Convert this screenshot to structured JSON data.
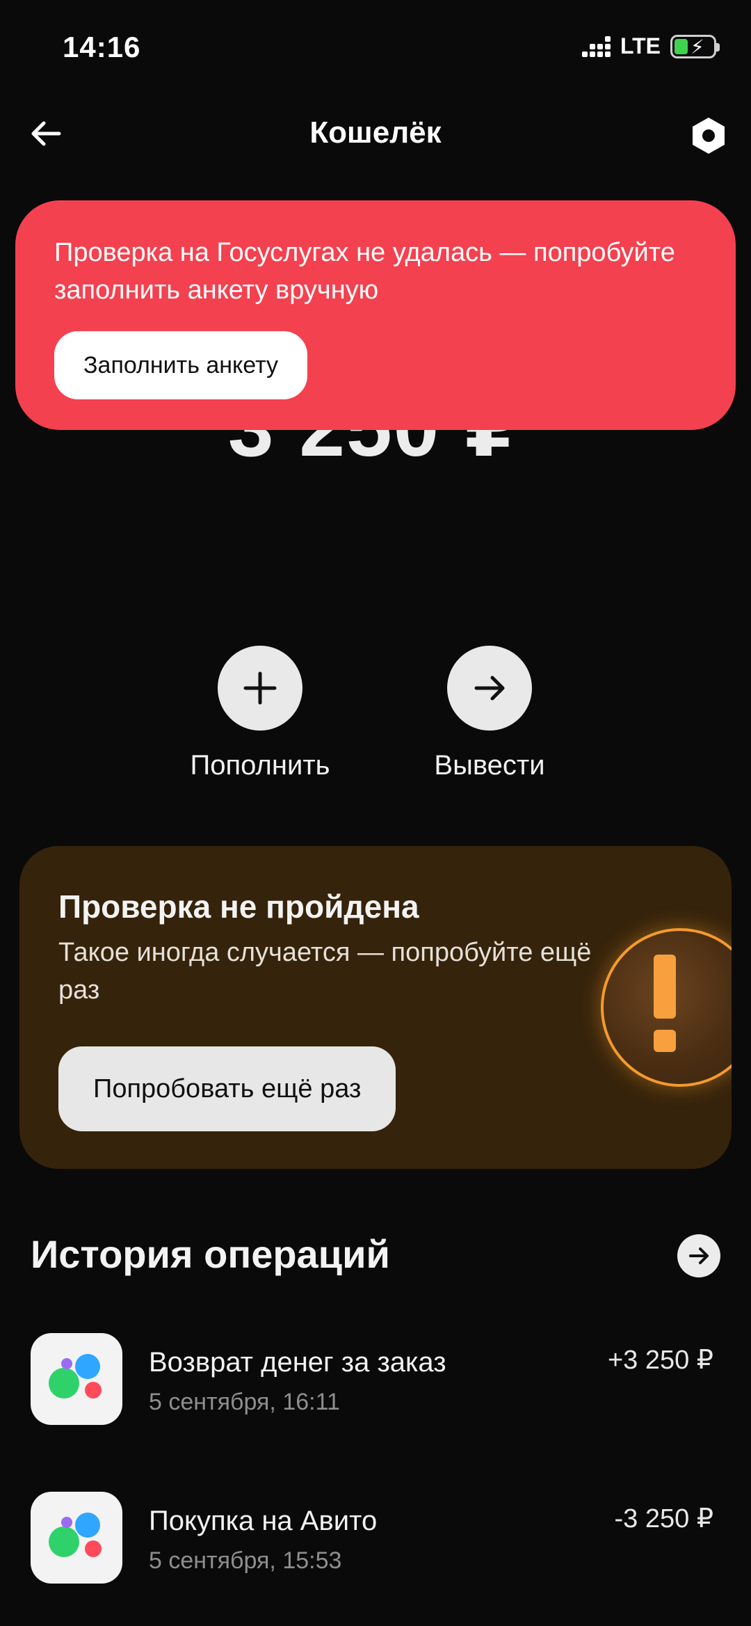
{
  "status_bar": {
    "time": "14:16",
    "network": "LTE",
    "battery_level": 0.35
  },
  "header": {
    "title": "Кошелёк",
    "back_icon": "arrow-left-icon",
    "settings_icon": "hexagon-gear-icon"
  },
  "balance": {
    "value": "3 250 ₽"
  },
  "toast": {
    "message": "Проверка на Госуслугах не удалась — попробуйте заполнить анкету вручную",
    "button_label": "Заполнить анкету",
    "color": "#f4414f"
  },
  "actions": [
    {
      "label": "Пополнить",
      "icon": "plus-icon"
    },
    {
      "label": "Вывести",
      "icon": "arrow-right-icon"
    }
  ],
  "verification": {
    "title": "Проверка не пройдена",
    "text": "Такое иногда случается — попробуйте ещё раз",
    "button_label": "Попробовать ещё раз",
    "icon": "warning-exclamation-icon",
    "accent": "#f59a2d"
  },
  "history": {
    "title": "История операций",
    "operations": [
      {
        "title": "Возврат денег за заказ",
        "date": "5 сентября, 16:11",
        "amount": "+3 250 ₽",
        "icon": "avito-logo-icon"
      },
      {
        "title": "Покупка на Авито",
        "date": "5 сентября, 15:53",
        "amount": "-3 250 ₽",
        "icon": "avito-logo-icon"
      }
    ]
  }
}
